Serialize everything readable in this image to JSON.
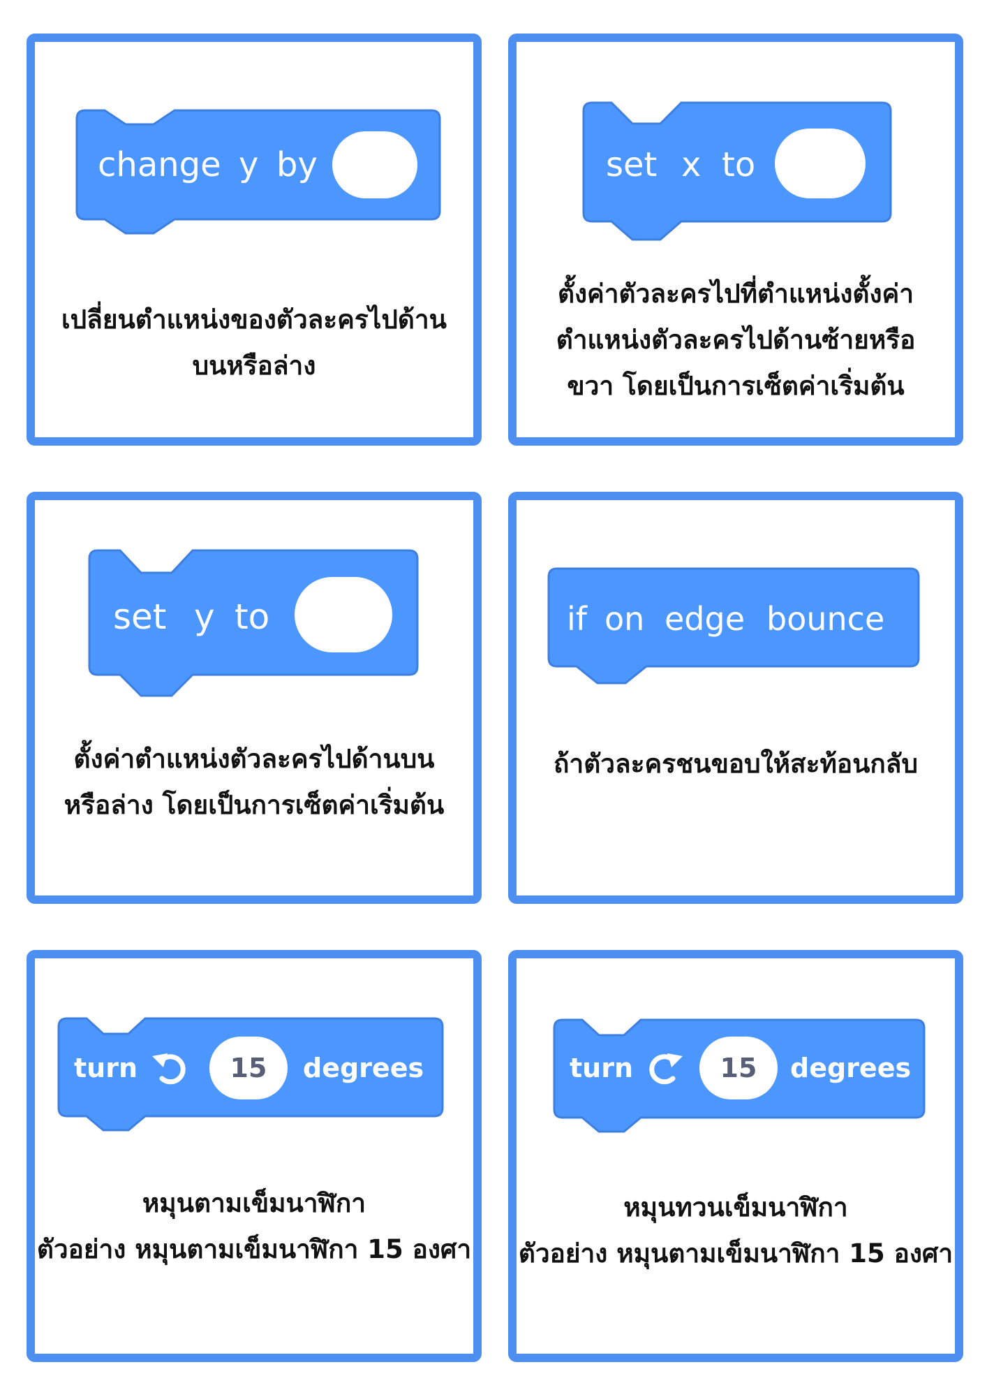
{
  "colors": {
    "accent": "#4d8ff0",
    "block": "#4c97ff",
    "block_border": "#3d7fe0"
  },
  "cards": [
    {
      "block": {
        "parts": [
          "change",
          "y",
          "by"
        ]
      },
      "desc": [
        "เปลี่ยนตำแหน่งของตัวละครไปด้าน",
        "บนหรือล่าง"
      ]
    },
    {
      "block": {
        "parts": [
          "set",
          "x",
          "to"
        ]
      },
      "desc": [
        "ตั้งค่าตัวละครไปที่ตำแหน่งตั้งค่า",
        "ตำแหน่งตัวละครไปด้านซ้ายหรือ",
        "ขวา โดยเป็นการเซ็ตค่าเริ่มต้น"
      ]
    },
    {
      "block": {
        "parts": [
          "set",
          "y",
          "to"
        ]
      },
      "desc": [
        "ตั้งค่าตำแหน่งตัวละครไปด้านบน",
        "หรือล่าง โดยเป็นการเซ็ตค่าเริ่มต้น"
      ]
    },
    {
      "block": {
        "parts": [
          "if",
          "on",
          "edge",
          "bounce"
        ]
      },
      "desc": [
        "ถ้าตัวละครชนขอบให้สะท้อนกลับ"
      ]
    },
    {
      "block": {
        "turn_label": "turn",
        "icon": "rotate-left-icon",
        "value": "15",
        "unit": "degrees"
      },
      "desc": [
        "หมุนตามเข็มนาฬิกา",
        "ตัวอย่าง หมุนตามเข็มนาฬิกา 15 องศา"
      ]
    },
    {
      "block": {
        "turn_label": "turn",
        "icon": "rotate-right-icon",
        "value": "15",
        "unit": "degrees"
      },
      "desc": [
        "หมุนทวนเข็มนาฬิกา",
        "ตัวอย่าง หมุนตามเข็มนาฬิกา 15 องศา"
      ]
    }
  ]
}
